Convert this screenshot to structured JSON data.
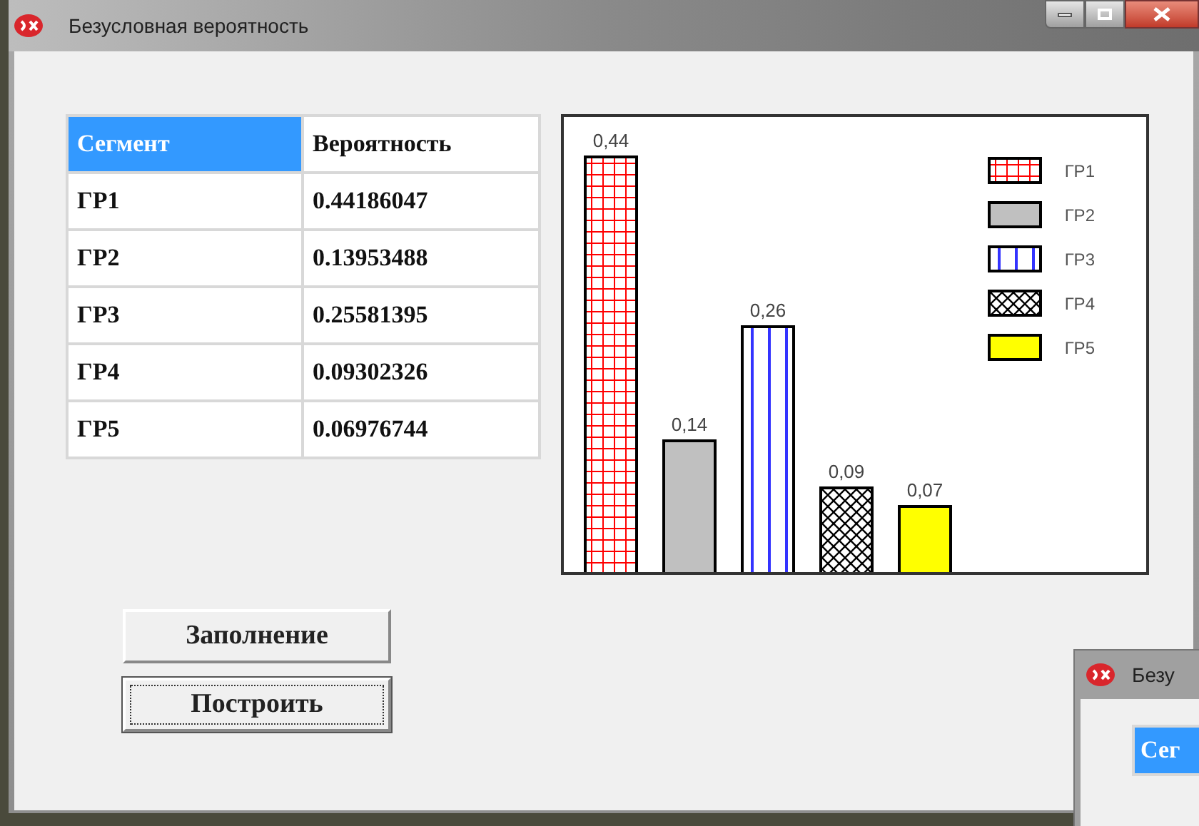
{
  "window": {
    "title": "Безусловная вероятность"
  },
  "table": {
    "columns": [
      "Сегмент",
      "Вероятность"
    ],
    "rows": [
      [
        "ГР1",
        "0.44186047"
      ],
      [
        "ГР2",
        "0.13953488"
      ],
      [
        "ГР3",
        "0.25581395"
      ],
      [
        "ГР4",
        "0.09302326"
      ],
      [
        "ГР5",
        "0.06976744"
      ]
    ]
  },
  "chart": {
    "bars": [
      {
        "value_label": "0,44",
        "kind": "grid",
        "color": "#ff0000"
      },
      {
        "value_label": "0,14",
        "kind": "solid",
        "color": "#c0c0c0"
      },
      {
        "value_label": "0,26",
        "kind": "stripes",
        "color": "#3333ff"
      },
      {
        "value_label": "0,09",
        "kind": "crosshatch",
        "color": "#000000"
      },
      {
        "value_label": "0,07",
        "kind": "solid",
        "color": "#ffff00"
      }
    ],
    "legend": [
      {
        "label": "ГР1",
        "kind": "grid",
        "color": "#ff0000"
      },
      {
        "label": "ГР2",
        "kind": "solid",
        "color": "#c0c0c0"
      },
      {
        "label": "ГР3",
        "kind": "stripes",
        "color": "#3333ff"
      },
      {
        "label": "ГР4",
        "kind": "crosshatch",
        "color": "#000000"
      },
      {
        "label": "ГР5",
        "kind": "solid",
        "color": "#ffff00"
      }
    ]
  },
  "buttons": [
    {
      "label": "Заполнение",
      "focused": false
    },
    {
      "label": "Построить",
      "focused": true
    }
  ],
  "second_window": {
    "title": "Безу",
    "table_header": "Сег"
  }
}
